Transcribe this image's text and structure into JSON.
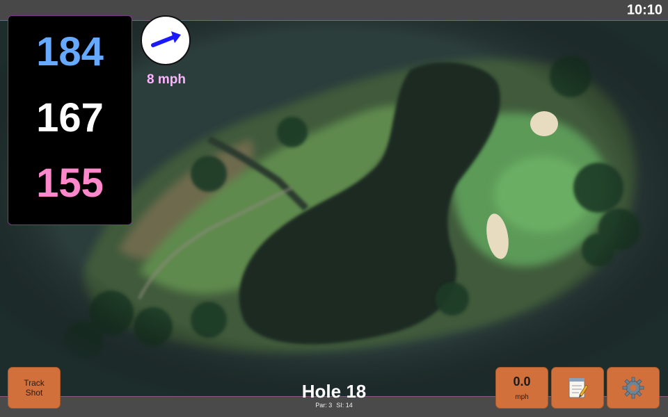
{
  "status": {
    "time": "10:10"
  },
  "yardage": {
    "back": "184",
    "middle": "167",
    "front": "155"
  },
  "wind": {
    "speed": "8 mph",
    "icon": "wind-direction-arrow-icon"
  },
  "controls": {
    "track_shot_label": "Track Shot",
    "speed_value": "0.0",
    "speed_unit": "mph",
    "notes_icon": "notepad-icon",
    "settings_icon": "gear-icon"
  },
  "hole": {
    "title": "Hole 18",
    "par": "Par: 3",
    "si": "SI: 14"
  },
  "colors": {
    "back": "#66aaff",
    "middle": "#ffffff",
    "front": "#ff88cc",
    "button": "#d2703c",
    "wind_text": "#ffb3ff"
  }
}
